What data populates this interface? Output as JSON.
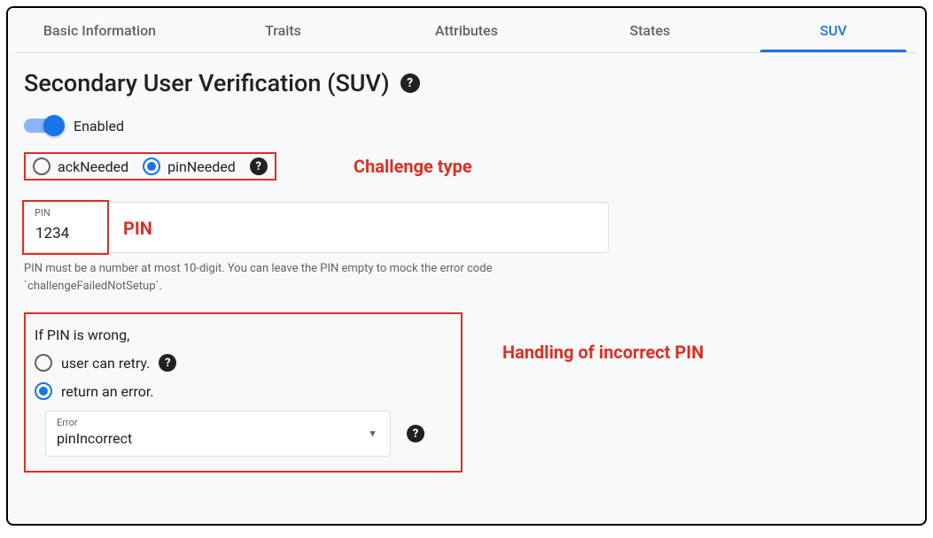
{
  "tabs": [
    {
      "label": "Basic Information"
    },
    {
      "label": "Traits"
    },
    {
      "label": "Attributes"
    },
    {
      "label": "States"
    },
    {
      "label": "SUV",
      "active": true
    }
  ],
  "page_title": "Secondary User Verification (SUV)",
  "toggle": {
    "label": "Enabled",
    "state": true
  },
  "challenge": {
    "options": [
      {
        "label": "ackNeeded",
        "selected": false
      },
      {
        "label": "pinNeeded",
        "selected": true
      }
    ],
    "annotation": "Challenge type"
  },
  "pin": {
    "label": "PIN",
    "value": "1234",
    "helper": "PIN must be a number at most 10-digit. You can leave the PIN empty to mock the error code `challengeFailedNotSetup`.",
    "annotation": "PIN"
  },
  "wrongPin": {
    "title": "If PIN is wrong,",
    "options": [
      {
        "label": "user can retry.",
        "selected": false,
        "hasHelp": true
      },
      {
        "label": "return an error.",
        "selected": true,
        "hasHelp": false
      }
    ],
    "errorSelect": {
      "label": "Error",
      "value": "pinIncorrect"
    },
    "annotation": "Handling of incorrect PIN"
  },
  "colors": {
    "accent": "#1a73e8",
    "annotation": "#d93025"
  }
}
